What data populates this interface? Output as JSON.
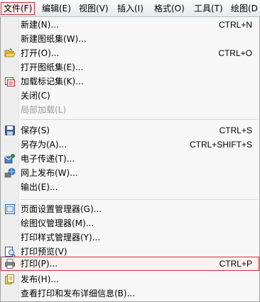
{
  "menubar": {
    "items": [
      {
        "label": "文件(F)"
      },
      {
        "label": "编辑(E)"
      },
      {
        "label": "视图(V)"
      },
      {
        "label": "插入(I)"
      },
      {
        "label": "格式(O)"
      },
      {
        "label": "工具(T)"
      },
      {
        "label": "绘图(D"
      }
    ]
  },
  "file_menu": {
    "new": {
      "label": "新建(N)...",
      "shortcut": "CTRL+N"
    },
    "new_sheet_set": {
      "label": "新建图纸集(W)..."
    },
    "open": {
      "label": "打开(O)...",
      "shortcut": "CTRL+O"
    },
    "open_sheet_set": {
      "label": "打开图纸集(E)..."
    },
    "load_markup_set": {
      "label": "加载标记集(K)..."
    },
    "close": {
      "label": "关闭(C)"
    },
    "partial_load": {
      "label": "局部加载(L)"
    },
    "save": {
      "label": "保存(S)",
      "shortcut": "CTRL+S"
    },
    "save_as": {
      "label": "另存为(A)...",
      "shortcut": "CTRL+SHIFT+S"
    },
    "etransmit": {
      "label": "电子传递(T)..."
    },
    "publish_to_web": {
      "label": "网上发布(W)..."
    },
    "export": {
      "label": "输出(E)..."
    },
    "page_setup_manager": {
      "label": "页面设置管理器(G)..."
    },
    "plotter_manager": {
      "label": "绘图仪管理器(M)..."
    },
    "plot_style_manager": {
      "label": "打印样式管理器(Y)..."
    },
    "plot_preview": {
      "label": "打印预览(V)"
    },
    "plot": {
      "label": "打印(P)...",
      "shortcut": "CTRL+P"
    },
    "publish": {
      "label": "发布(H)..."
    },
    "plot_publish_details": {
      "label": "查看打印和发布详细信息(B)..."
    }
  },
  "icons": {
    "open": "folder-open-icon",
    "load_markup_set": "markup-set-icon",
    "save": "floppy-disk-icon",
    "etransmit": "etransmit-icon",
    "publish_to_web": "globe-icon",
    "page_setup_manager": "page-setup-icon",
    "plot_preview": "plot-preview-icon",
    "plot": "printer-icon",
    "publish": "publish-icon"
  },
  "colors": {
    "highlight_border": "#d0303a",
    "disabled_text": "#9a9a9a"
  }
}
